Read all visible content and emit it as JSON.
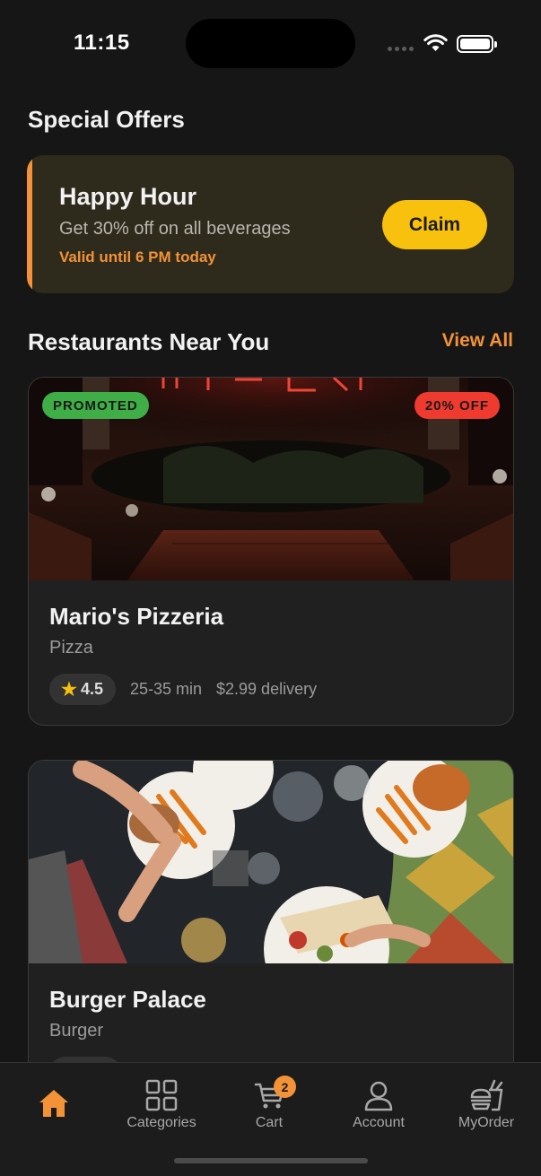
{
  "status_bar": {
    "time": "11:15"
  },
  "offers": {
    "section_title": "Special Offers",
    "card": {
      "title": "Happy Hour",
      "description": "Get 30% off on all beverages",
      "validity": "Valid until 6 PM today",
      "button_label": "Claim"
    }
  },
  "nearby": {
    "section_title": "Restaurants Near You",
    "view_all_label": "View All",
    "restaurants": [
      {
        "name": "Mario's Pizzeria",
        "category": "Pizza",
        "rating": "4.5",
        "delivery_time": "25-35 min",
        "delivery_fee": "$2.99 delivery",
        "promoted_badge": "PROMOTED",
        "discount_badge": "20% OFF"
      },
      {
        "name": "Burger Palace",
        "category": "Burger"
      }
    ]
  },
  "tab_bar": {
    "items": [
      {
        "label": "",
        "icon": "home-icon",
        "active": true
      },
      {
        "label": "Categories",
        "icon": "grid-icon"
      },
      {
        "label": "Cart",
        "icon": "cart-icon",
        "badge": "2"
      },
      {
        "label": "Account",
        "icon": "user-icon"
      },
      {
        "label": "MyOrder",
        "icon": "food-order-icon"
      }
    ]
  },
  "colors": {
    "accent": "#f39237",
    "claim_button": "#f8c10d",
    "promoted": "#3fae47",
    "discount": "#ef3b2f",
    "background": "#161616"
  }
}
